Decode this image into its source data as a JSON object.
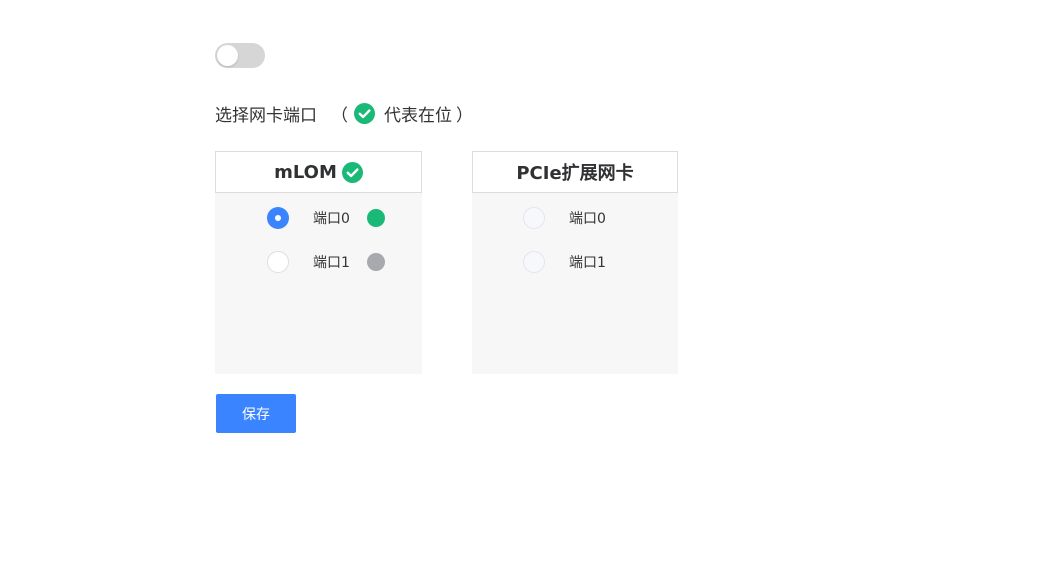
{
  "toggle": {
    "enabled": false
  },
  "hint": {
    "label": "选择网卡端口",
    "paren_open": "（",
    "legend_text": "代表在位",
    "paren_close": "）",
    "icon": "check-circle-icon"
  },
  "colors": {
    "present": "#1bb978",
    "absent": "#a6a9ae",
    "primary": "#3a84ff"
  },
  "cards": [
    {
      "title": "mLOM",
      "present": true,
      "ports": [
        {
          "label": "端口0",
          "selected": true,
          "status": "present"
        },
        {
          "label": "端口1",
          "selected": false,
          "status": "absent"
        }
      ]
    },
    {
      "title": "PCIe扩展网卡",
      "present": false,
      "ports": [
        {
          "label": "端口0",
          "selected": false
        },
        {
          "label": "端口1",
          "selected": false
        }
      ]
    }
  ],
  "save_button": {
    "label": "保存"
  }
}
